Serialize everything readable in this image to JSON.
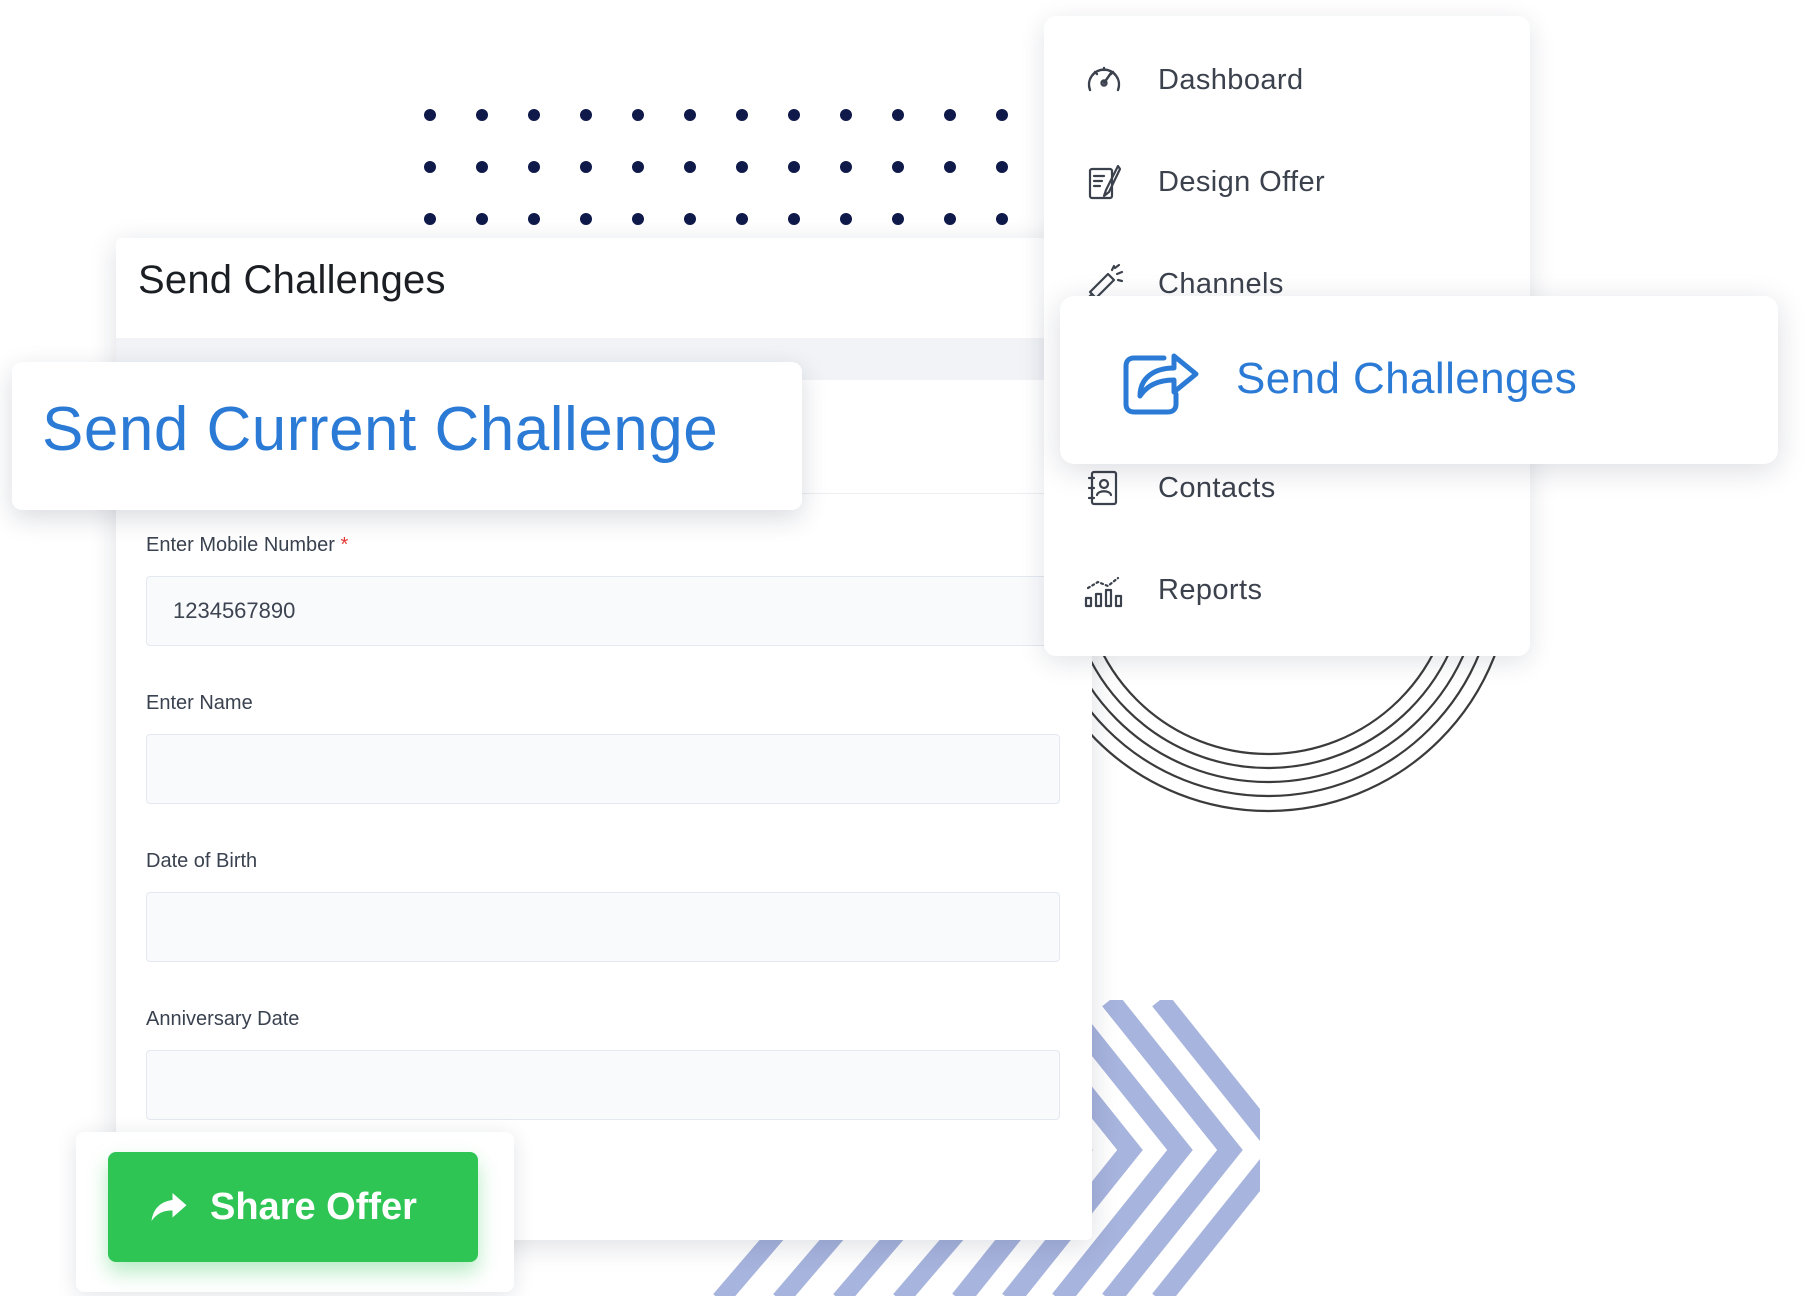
{
  "form": {
    "title": "Send Challenges",
    "fields": [
      {
        "label": "Enter Mobile Number",
        "required": true,
        "value": "1234567890",
        "placeholder": ""
      },
      {
        "label": "Enter Name",
        "required": false,
        "value": "",
        "placeholder": ""
      },
      {
        "label": "Date of Birth",
        "required": false,
        "value": "",
        "placeholder": ""
      },
      {
        "label": "Anniversary Date",
        "required": false,
        "value": "",
        "placeholder": ""
      }
    ],
    "required_marker": "*"
  },
  "overlay_title": "Send Current Challenge",
  "share_button": {
    "label": "Share Offer",
    "icon": "share-arrow-icon"
  },
  "menu": {
    "items": [
      {
        "label": "Dashboard",
        "icon": "speedometer-icon"
      },
      {
        "label": "Design Offer",
        "icon": "design-pencil-icon"
      },
      {
        "label": "Channels",
        "icon": "megaphone-icon"
      },
      {
        "label": "Contacts",
        "icon": "contact-book-icon"
      },
      {
        "label": "Reports",
        "icon": "bar-chart-icon"
      }
    ],
    "active": {
      "label": "Send Challenges",
      "icon": "share-box-icon"
    }
  },
  "colors": {
    "accent_blue": "#2b7bd6",
    "share_green": "#2fc555",
    "required_red": "#e53935",
    "dots_navy": "#0f1a4a",
    "chevron_blue": "#a7b4de"
  }
}
